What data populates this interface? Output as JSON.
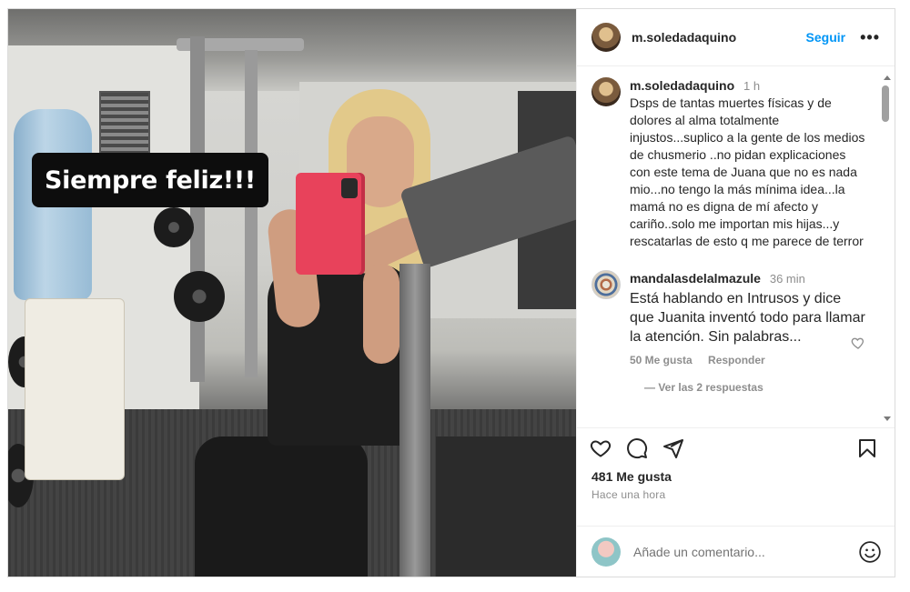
{
  "post": {
    "sticker_text": "Siempre feliz!!!",
    "author": "m.soledadaquino",
    "follow_label": "Seguir",
    "more_label": "•••"
  },
  "caption": {
    "user": "m.soledadaquino",
    "time": "1 h",
    "text": "Dsps de tantas muertes físicas y de dolores al alma totalmente injustos...suplico a la gente de los medios de chusmerio ..no pidan explicaciones con este tema de Juana que no es nada mio...no tengo la más mínima idea...la mamá no es digna de mí afecto y cariño..solo me importan mis hijas...y rescatarlas de esto q me parece de terror"
  },
  "comment": {
    "user": "mandalasdelalmazule",
    "time": "36 min",
    "text": "Está hablando en Intrusos y dice que Juanita inventó todo para llamar la atención. Sin palabras...",
    "likes_label": "50 Me gusta",
    "reply_label": "Responder",
    "view_replies": "— Ver las 2 respuestas"
  },
  "stats": {
    "likes": "481 Me gusta",
    "posted": "Hace una hora"
  },
  "add_comment": {
    "placeholder": "Añade un comentario..."
  },
  "icons": [
    "heart-icon",
    "comment-icon",
    "share-icon",
    "bookmark-icon",
    "emoji-icon",
    "more-icon"
  ],
  "colors": {
    "link_blue": "#0095f6",
    "muted": "#8e8e8e",
    "text": "#262626",
    "phone_case": "#e8425b"
  }
}
